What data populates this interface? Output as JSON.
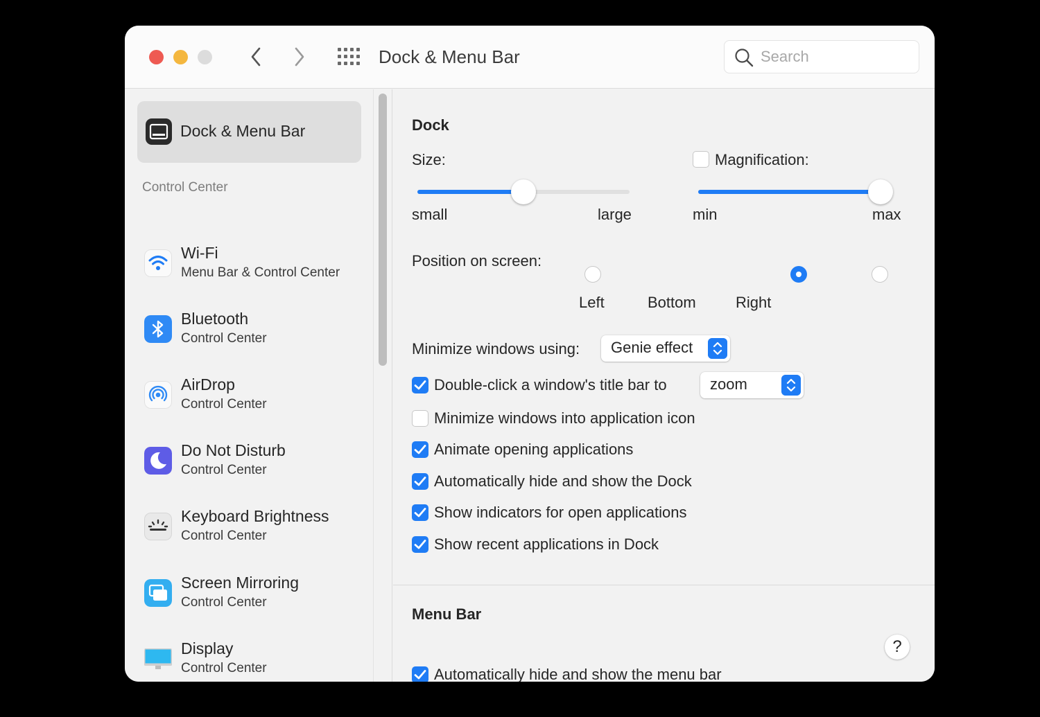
{
  "window": {
    "title": "Dock & Menu Bar",
    "search_placeholder": "Search"
  },
  "sidebar": {
    "selected": "Dock & Menu Bar",
    "section_title": "Control Center",
    "items": [
      {
        "name": "Wi-Fi",
        "sub": "Menu Bar & Control Center",
        "icon": "wifi-icon"
      },
      {
        "name": "Bluetooth",
        "sub": "Control Center",
        "icon": "bluetooth-icon"
      },
      {
        "name": "AirDrop",
        "sub": "Control Center",
        "icon": "airdrop-icon"
      },
      {
        "name": "Do Not Disturb",
        "sub": "Control Center",
        "icon": "moon-icon"
      },
      {
        "name": "Keyboard Brightness",
        "sub": "Control Center",
        "icon": "keyboard-brightness-icon"
      },
      {
        "name": "Screen Mirroring",
        "sub": "Control Center",
        "icon": "screen-mirroring-icon"
      },
      {
        "name": "Display",
        "sub": "Control Center",
        "icon": "display-icon"
      }
    ]
  },
  "dock": {
    "heading": "Dock",
    "size_label": "Size:",
    "size_min": "small",
    "size_max": "large",
    "size_value": 0.5,
    "magnification_label": "Magnification:",
    "magnification_checked": false,
    "mag_min": "min",
    "mag_max": "max",
    "mag_value": 0.98,
    "position_label": "Position on screen:",
    "positions": [
      "Left",
      "Bottom",
      "Right"
    ],
    "position_selected": "Bottom",
    "minimize_label": "Minimize windows using:",
    "minimize_value": "Genie effect",
    "doubleclick_label": "Double-click a window's title bar to",
    "doubleclick_value": "zoom",
    "doubleclick_checked": true,
    "options": [
      {
        "label": "Minimize windows into application icon",
        "checked": false
      },
      {
        "label": "Animate opening applications",
        "checked": true
      },
      {
        "label": "Automatically hide and show the Dock",
        "checked": true
      },
      {
        "label": "Show indicators for open applications",
        "checked": true
      },
      {
        "label": "Show recent applications in Dock",
        "checked": true
      }
    ]
  },
  "menubar": {
    "heading": "Menu Bar",
    "autohide_label": "Automatically hide and show the menu bar",
    "autohide_checked": true
  },
  "help_label": "?",
  "colors": {
    "accent": "#1f7cf5",
    "close": "#ee5a52",
    "minimize": "#f4b73f"
  }
}
